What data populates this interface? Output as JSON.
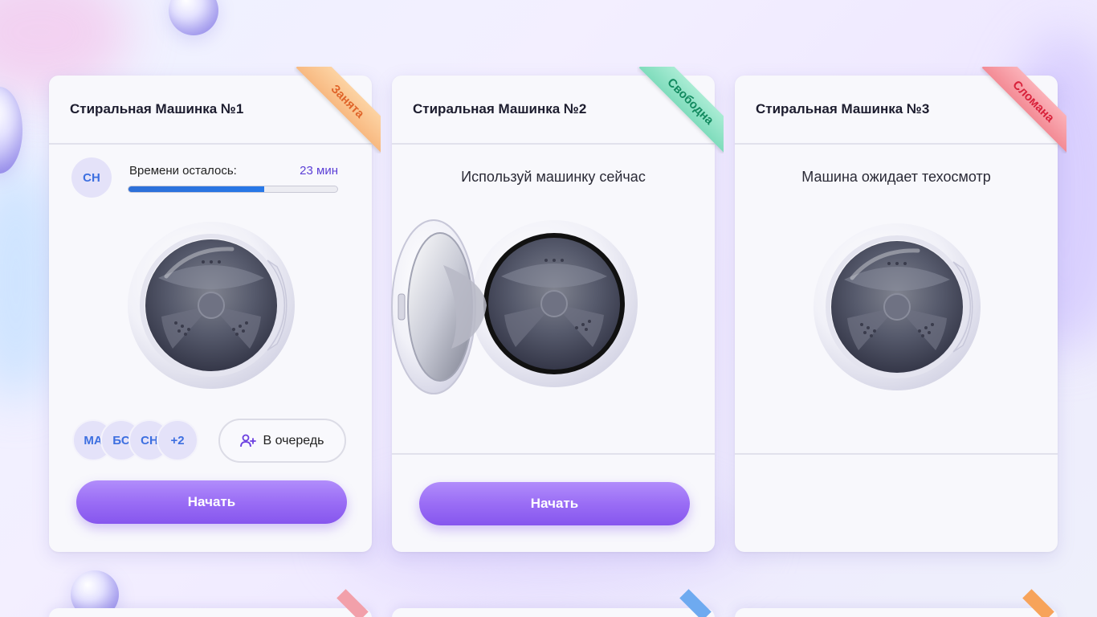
{
  "machines": [
    {
      "title": "Стиральная Машинка №1",
      "status": "Занята",
      "status_color": "#f7a35a",
      "current_user": "СН",
      "time_label": "Времени осталось:",
      "time_value": "23 мин",
      "progress_fraction": 0.65,
      "queue": [
        "МА",
        "БС",
        "СН"
      ],
      "queue_more": "+2",
      "queue_button": "В очередь",
      "start_button": "Начать"
    },
    {
      "title": "Стиральная Машинка №2",
      "status": "Свободна",
      "status_color": "#5fd3ad",
      "message": "Используй машинку сейчас",
      "start_button": "Начать"
    },
    {
      "title": "Стиральная Машинка №3",
      "status": "Сломана",
      "status_color": "#f2707a",
      "message": "Машина ожидает техосмотр"
    }
  ],
  "next_row_status_colors": [
    "#f2a0aa",
    "#6eaaf0",
    "#f7a35a"
  ],
  "accent_color": "#9a6df5"
}
